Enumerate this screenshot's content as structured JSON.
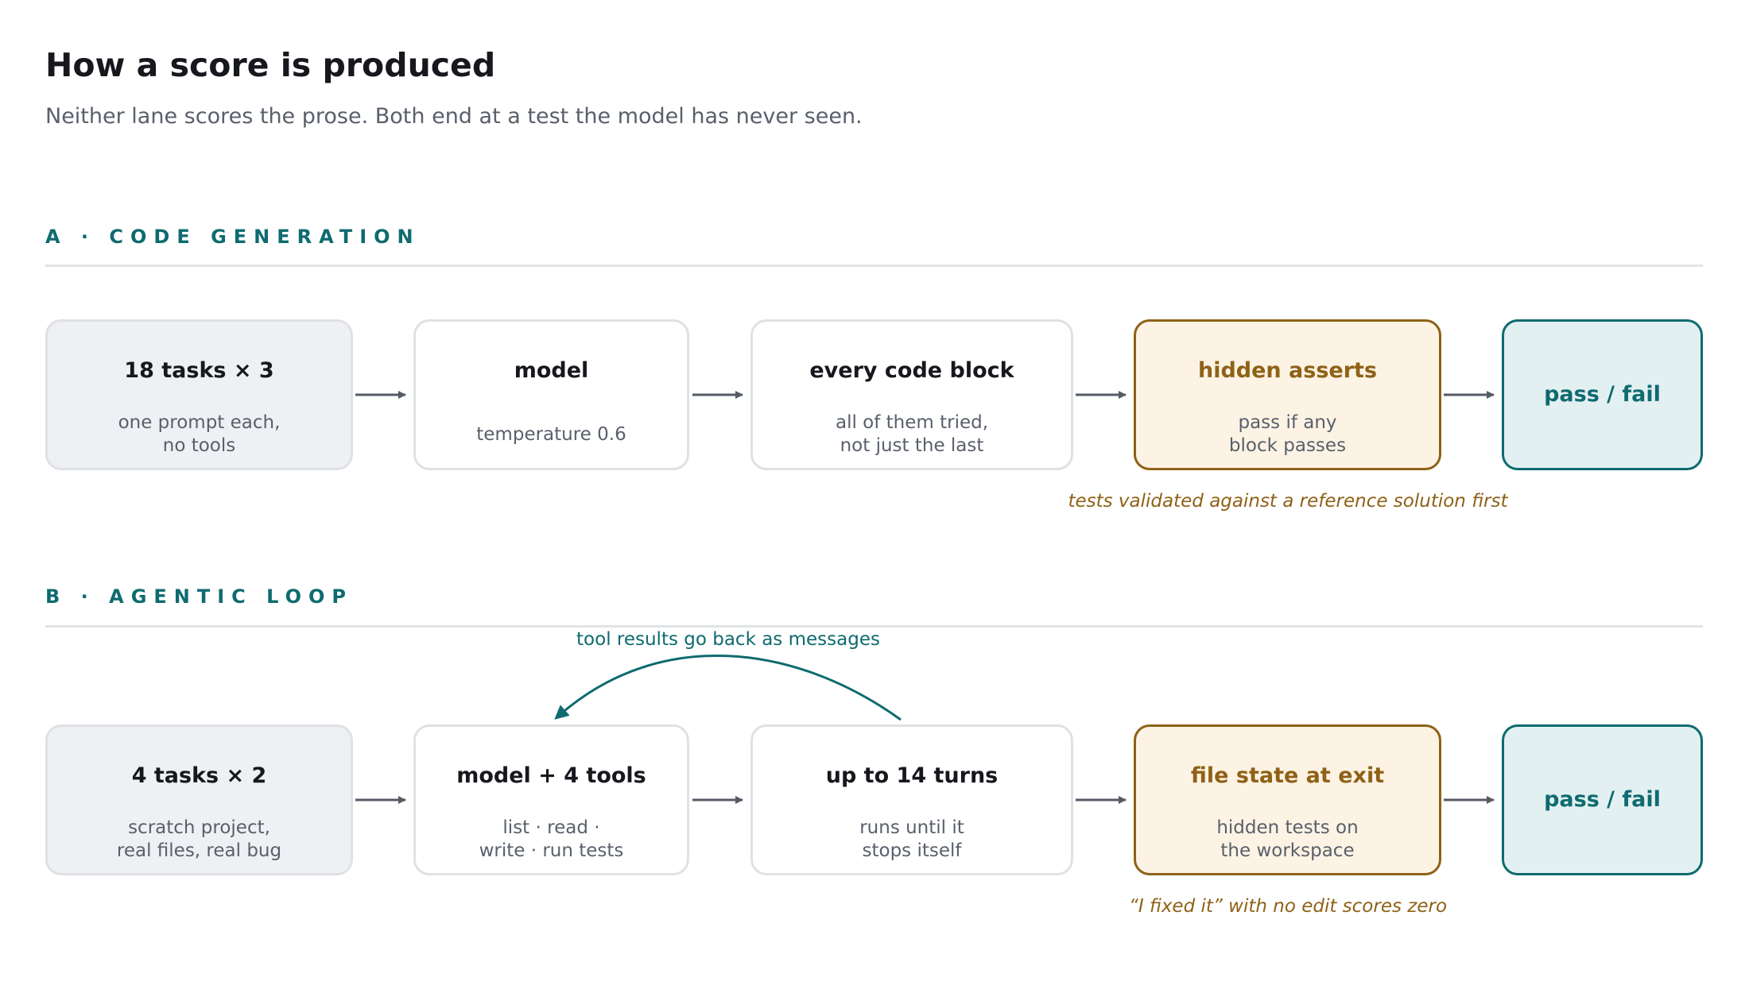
{
  "title": "How a score is produced",
  "subtitle": "Neither lane scores the prose. Both end at a test the model has never seen.",
  "lane_a": {
    "label": "A · CODE GENERATION",
    "steps": [
      {
        "title": "18 tasks × 3",
        "sub": "one prompt each,\nno tools"
      },
      {
        "title": "model",
        "sub": "temperature 0.6"
      },
      {
        "title": "every code block",
        "sub": "all of them tried,\nnot just the last"
      },
      {
        "title": "hidden asserts",
        "sub": "pass if any\nblock passes"
      },
      {
        "title": "pass / fail",
        "sub": ""
      }
    ],
    "note": "tests validated against a reference solution first"
  },
  "lane_b": {
    "label": "B · AGENTIC LOOP",
    "loop_label": "tool results go back as messages",
    "steps": [
      {
        "title": "4 tasks × 2",
        "sub": "scratch project,\nreal files, real bug"
      },
      {
        "title": "model + 4 tools",
        "sub": "list · read ·\nwrite · run tests"
      },
      {
        "title": "up to 14 turns",
        "sub": "runs until it\nstops itself"
      },
      {
        "title": "file state at exit",
        "sub": "hidden tests on\nthe workspace"
      },
      {
        "title": "pass / fail",
        "sub": ""
      }
    ],
    "note": "“I fixed it” with no edit scores zero"
  },
  "colors": {
    "accent_teal": "#0e6b70",
    "accent_amber": "#8f6117",
    "arrow": "#555b66"
  }
}
